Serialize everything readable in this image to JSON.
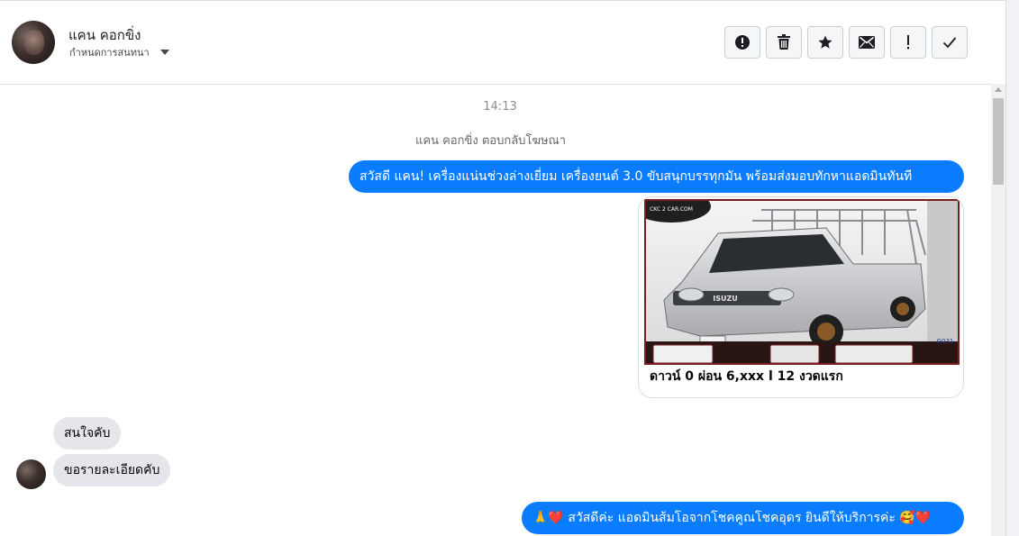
{
  "header": {
    "contact_name": "แคน คอกขิ่ง",
    "assign_label": "กำหนดการสนทนา",
    "toolbar": [
      {
        "name": "spam-button",
        "icon": "alert-icon"
      },
      {
        "name": "delete-button",
        "icon": "trash-icon"
      },
      {
        "name": "star-button",
        "icon": "star-icon"
      },
      {
        "name": "mark-unread-button",
        "icon": "envelope-icon"
      },
      {
        "name": "follow-up-button",
        "icon": "exclamation-icon"
      },
      {
        "name": "mark-done-button",
        "icon": "check-icon"
      }
    ]
  },
  "thread": {
    "timestamp": "14:13",
    "system_note": "แคน คอกขิ่ง ตอบกลับโฆษณา",
    "messages": [
      {
        "direction": "outgoing",
        "text": "สวัสดี แคน! เครื่องแน่นช่วงล่างเยี่ยม เครื่องยนต์ 3.0 ขับสนุกบรรทุกมัน พร้อมส่งมอบทักหาแอดมินทันที"
      },
      {
        "direction": "outgoing",
        "type": "ad-card",
        "image_watermark": "CKC 2 CAR.COM",
        "image_badge": "G031",
        "caption": "ดาวน์ 0 ผ่อน 6,xxx l 12 งวดแรก"
      },
      {
        "direction": "incoming",
        "text": "สนใจคับ"
      },
      {
        "direction": "incoming",
        "text": "ขอรายละเอียดคับ"
      },
      {
        "direction": "outgoing",
        "text_prefix": "🙏❤️",
        "text": " สวัสดีค่ะ แอดมินส้มโอจากโชคคูณโชคอุดร ยินดีให้บริการค่ะ ",
        "text_suffix": "🥰❤️"
      }
    ]
  },
  "colors": {
    "outgoing_bubble": "#0a7cff",
    "incoming_bubble": "#e4e6eb",
    "border": "#dadde1"
  }
}
